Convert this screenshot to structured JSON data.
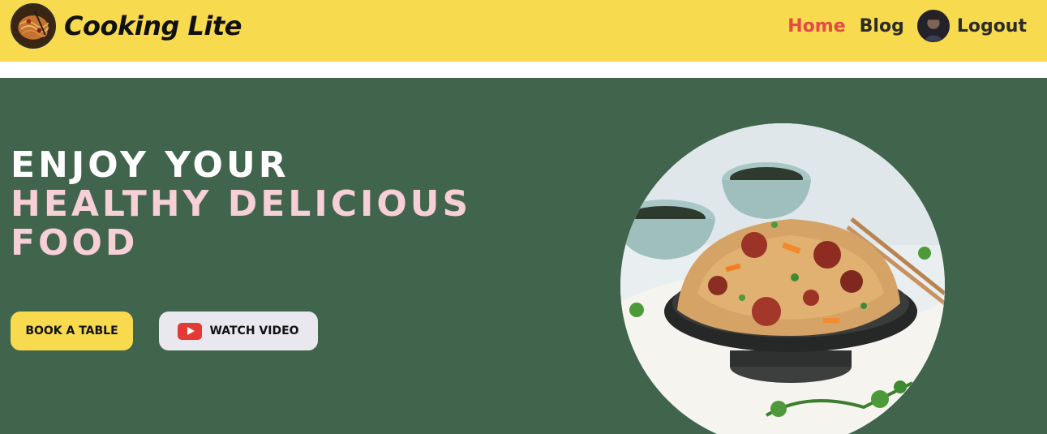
{
  "header": {
    "brand_name": "Cooking Lite",
    "nav": {
      "home": "Home",
      "blog": "Blog",
      "logout": "Logout"
    },
    "colors": {
      "background": "#f8da4e",
      "active_link": "#e64848"
    }
  },
  "hero": {
    "headline_line1": "ENJOY YOUR",
    "headline_line2": "HEALTHY DELICIOUS",
    "headline_line3": "FOOD",
    "book_button": "BOOK A TABLE",
    "video_button": "WATCH VIDEO",
    "icons": {
      "video": "youtube-play-icon"
    },
    "colors": {
      "background": "#41644d",
      "accent_text": "#f7cfd6",
      "button": "#f8da4e"
    }
  }
}
